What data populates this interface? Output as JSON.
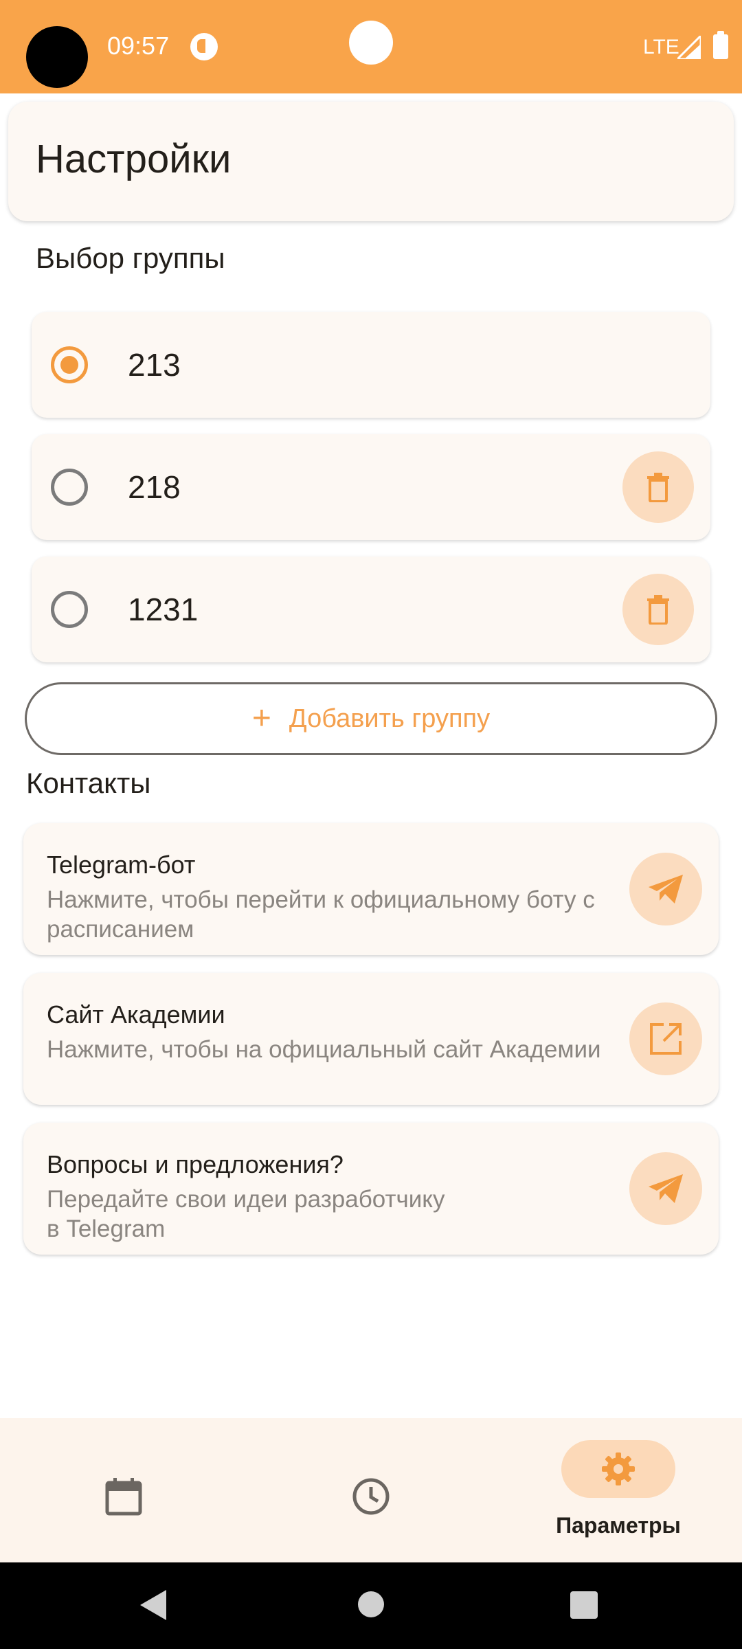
{
  "status_bar": {
    "time": "09:57",
    "network": "LTE",
    "icons": [
      "camera-cutout",
      "app-notification-icon",
      "signal-icon",
      "battery-icon"
    ]
  },
  "header": {
    "title": "Настройки"
  },
  "groups": {
    "section_title": "Выбор группы",
    "items": [
      {
        "name": "213",
        "selected": true,
        "deletable": false
      },
      {
        "name": "218",
        "selected": false,
        "deletable": true
      },
      {
        "name": "1231",
        "selected": false,
        "deletable": true
      }
    ],
    "add_label": "Добавить группу"
  },
  "contacts": {
    "section_title": "Контакты",
    "items": [
      {
        "title": "Telegram-бот",
        "description": "Нажмите, чтобы перейти к официальному боту с расписанием",
        "icon": "send-icon"
      },
      {
        "title": "Сайт Академии",
        "description": "Нажмите, чтобы на официальный сайт Академии",
        "icon": "open-in-new-icon"
      },
      {
        "title": "Вопросы и предложения?",
        "description": "Передайте свои идеи разработчику в Telegram",
        "icon": "send-icon"
      }
    ]
  },
  "bottom_nav": {
    "items": [
      {
        "icon": "calendar-icon",
        "label": "",
        "active": false
      },
      {
        "icon": "clock-icon",
        "label": "",
        "active": false
      },
      {
        "icon": "gear-icon",
        "label": "Параметры",
        "active": true
      }
    ]
  },
  "colors": {
    "accent": "#f9a44a",
    "accent_soft": "#fbdcbf",
    "card_bg": "#fdf8f3",
    "text_primary": "#231f1a",
    "text_secondary": "#8a8580"
  }
}
